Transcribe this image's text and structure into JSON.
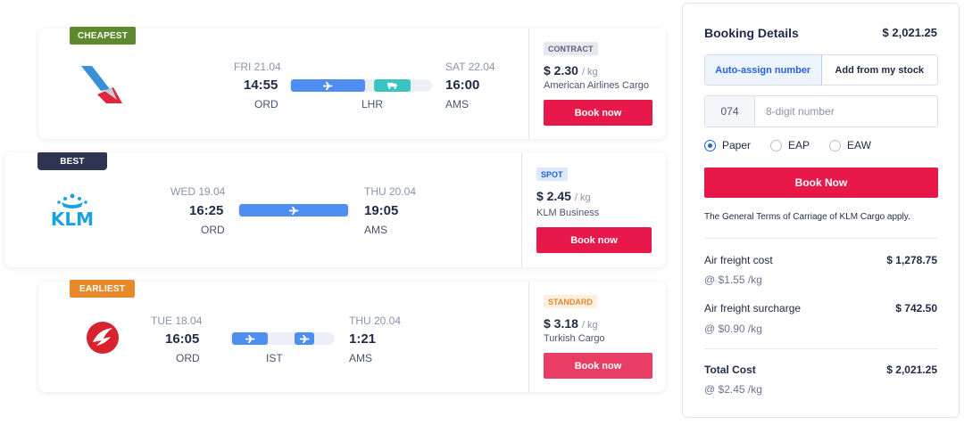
{
  "colors": {
    "primary": "#e8194a",
    "accent_blue": "#2462d9",
    "plane_seg": "#4d8ef0",
    "truck_seg": "#3dc3c3"
  },
  "offers": [
    {
      "badge": "CHEAPEST",
      "badge_color": "#5e8a2e",
      "logo": "american-airlines-logo",
      "dep_date": "FRI 21.04",
      "dep_time": "14:55",
      "origin": "ORD",
      "via": "LHR",
      "arr_date": "SAT 22.04",
      "arr_time": "16:00",
      "destination": "AMS",
      "rate_type": "CONTRACT",
      "rate_type_color": "#5a6478",
      "rate_type_bg": "#e6e9ef",
      "price": "$ 2.30",
      "unit": "/ kg",
      "carrier": "American Airlines Cargo",
      "book_label": "Book now"
    },
    {
      "badge": "BEST",
      "badge_color": "#2e3552",
      "logo": "klm-logo",
      "logo_text": "KLM",
      "dep_date": "WED 19.04",
      "dep_time": "16:25",
      "origin": "ORD",
      "arr_date": "THU 20.04",
      "arr_time": "19:05",
      "destination": "AMS",
      "rate_type": "SPOT",
      "rate_type_color": "#2462d9",
      "rate_type_bg": "#dde9fb",
      "price": "$ 2.45",
      "unit": "/ kg",
      "carrier": "KLM Business",
      "book_label": "Book now"
    },
    {
      "badge": "EARLIEST",
      "badge_color": "#e8892b",
      "logo": "turkish-airlines-logo",
      "dep_date": "TUE 18.04",
      "dep_time": "16:05",
      "origin": "ORD",
      "via": "IST",
      "arr_date": "THU 20.04",
      "arr_time": "1:21",
      "destination": "AMS",
      "rate_type": "STANDARD",
      "rate_type_color": "#e0882c",
      "rate_type_bg": "#fdf0e1",
      "price": "$ 3.18",
      "unit": "/ kg",
      "carrier": "Turkish Cargo",
      "book_label": "Book now"
    }
  ],
  "panel": {
    "title": "Booking Details",
    "total": "$ 2,021.25",
    "assign_options": [
      "Auto-assign number",
      "Add from my stock"
    ],
    "awb_prefix": "074",
    "awb_placeholder": "8-digit number",
    "doc_options": [
      "Paper",
      "EAP",
      "EAW"
    ],
    "doc_selected": "Paper",
    "book_now_label": "Book Now",
    "terms": "The General Terms of Carriage of KLM Cargo apply.",
    "costs": [
      {
        "label": "Air freight cost",
        "value": "$ 1,278.75",
        "rate": "@ $1.55 /kg"
      },
      {
        "label": "Air freight surcharge",
        "value": "$ 742.50",
        "rate": "@ $0.90 /kg"
      }
    ],
    "total_cost": {
      "label": "Total Cost",
      "value": "$ 2,021.25",
      "rate": "@ $2.45 /kg"
    }
  }
}
